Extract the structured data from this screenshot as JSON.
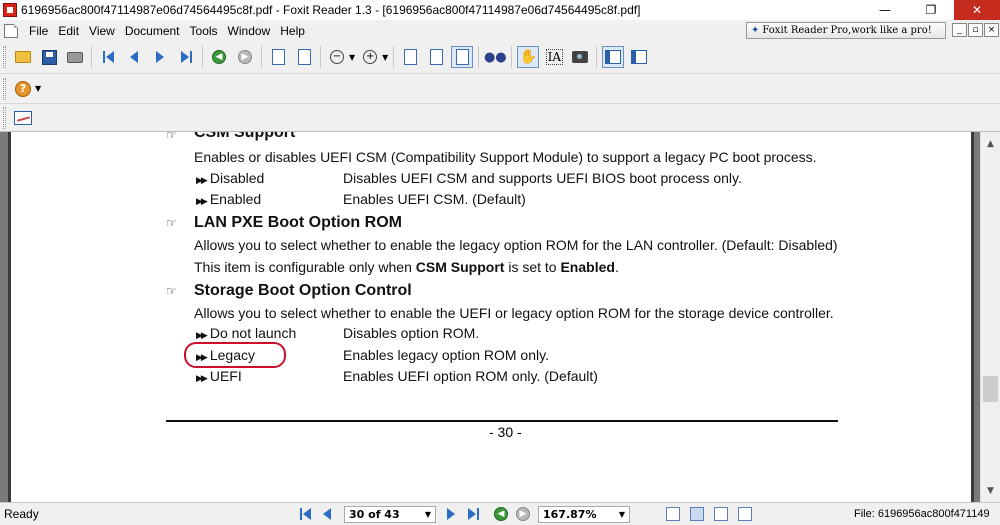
{
  "window": {
    "title": "6196956ac800f47114987e06d74564495c8f.pdf - Foxit Reader 1.3 - [6196956ac800f47114987e06d74564495c8f.pdf]",
    "minimize": "—",
    "maximize": "❐",
    "close": "✕"
  },
  "menu": {
    "items": [
      {
        "label": "File"
      },
      {
        "label": "Edit"
      },
      {
        "label": "View"
      },
      {
        "label": "Document"
      },
      {
        "label": "Tools"
      },
      {
        "label": "Window"
      },
      {
        "label": "Help"
      }
    ],
    "promo": "Foxit Reader Pro,work like a pro!",
    "mdi_min": "_",
    "mdi_restore": "▫",
    "mdi_close": "×"
  },
  "document": {
    "sections": [
      {
        "heading": "CSM Support",
        "desc": "Enables or disables UEFI CSM (Compatibility Support Module) to support a legacy PC boot process."
      },
      {
        "heading": "LAN PXE Boot Option ROM",
        "desc": "Allows you to select whether to enable the legacy option ROM for the LAN controller. (Default: Disabled)"
      },
      {
        "heading": "Storage Boot Option Control",
        "desc": "Allows you to select whether to enable the UEFI or legacy option ROM for the storage device controller."
      }
    ],
    "csm_options": [
      {
        "name": "Disabled",
        "desc": "Disables UEFI CSM and supports UEFI BIOS boot process only."
      },
      {
        "name": "Enabled",
        "desc": "Enables UEFI CSM. (Default)"
      }
    ],
    "lan_note": {
      "pre": "This item is configurable only when ",
      "b1": "CSM Support",
      "mid": " is set to ",
      "b2": "Enabled",
      "post": "."
    },
    "storage_options": [
      {
        "name": "Do not launch",
        "desc": "Disables option ROM."
      },
      {
        "name": "Legacy",
        "desc": "Enables legacy option ROM only."
      },
      {
        "name": "UEFI",
        "desc": "Enables UEFI option ROM only. (Default)"
      }
    ],
    "page_number": "- 30 -"
  },
  "statusbar": {
    "ready": "Ready",
    "page": "30 of 43",
    "zoom": "167.87%",
    "file": "File: 6196956ac800f471149"
  }
}
